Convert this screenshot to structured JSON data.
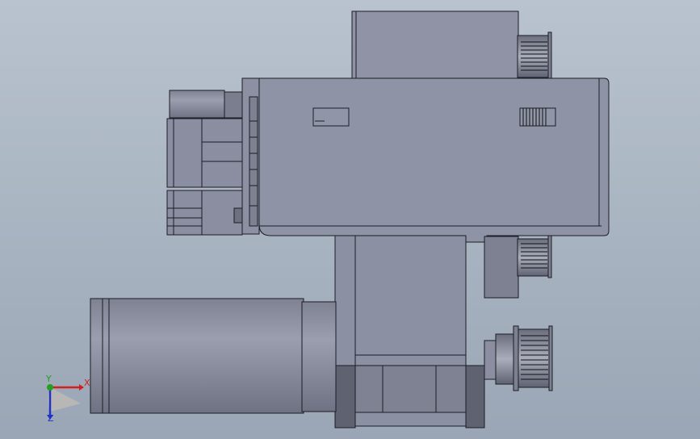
{
  "viewport": {
    "background_top": "#b9c3cf",
    "background_bottom": "#9aa6b5"
  },
  "model": {
    "fill_main": "#8e93a6",
    "fill_light": "#a3a7b7",
    "fill_dark": "#5d6170",
    "fill_face": "#898ea1",
    "edge": "#1c1d24"
  },
  "triad": {
    "x_label": "X",
    "y_label": "Y",
    "z_label": "Z",
    "x_color": "#d22020",
    "y_color": "#22a022",
    "z_color": "#2030c8"
  }
}
